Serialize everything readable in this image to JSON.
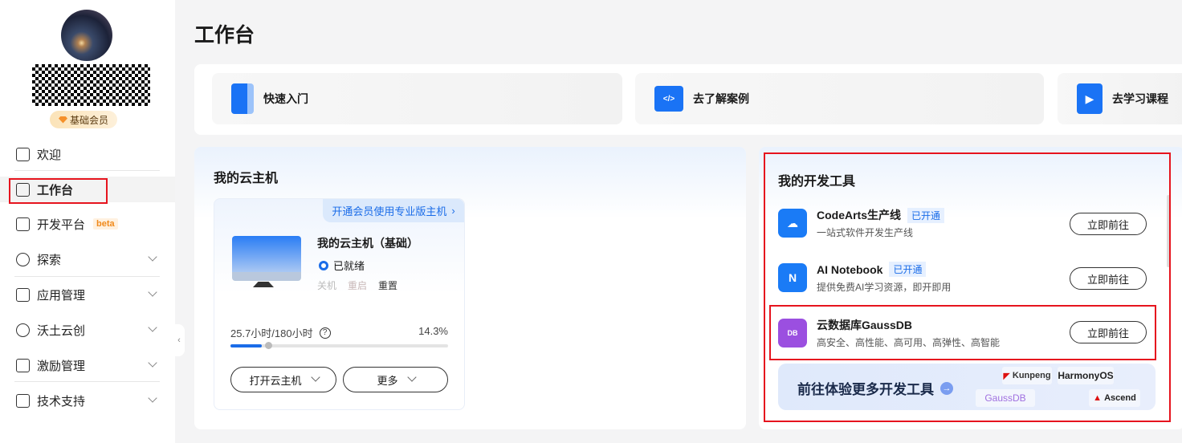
{
  "sidebar": {
    "member_badge": "基础会员",
    "items": [
      {
        "label": "欢迎",
        "icon": "home-icon"
      },
      {
        "label": "工作台",
        "icon": "workbench-icon",
        "selected": true
      },
      {
        "label": "开发平台",
        "icon": "dev-platform-icon",
        "badge": "beta"
      },
      {
        "label": "探索",
        "icon": "explore-icon"
      },
      {
        "label": "应用管理",
        "icon": "app-manage-icon"
      },
      {
        "label": "沃土云创",
        "icon": "cloud-icon"
      },
      {
        "label": "激励管理",
        "icon": "gift-icon"
      },
      {
        "label": "技术支持",
        "icon": "support-icon"
      }
    ]
  },
  "page_title": "工作台",
  "quick_links": [
    "快速入门",
    "去了解案例",
    "去学习课程"
  ],
  "cloud_host": {
    "title": "我的云主机",
    "upsell": "开通会员使用专业版主机",
    "name": "我的云主机（基础）",
    "status": "已就绪",
    "actions": [
      "关机",
      "重启",
      "重置"
    ],
    "usage": "25.7小时/180小时",
    "percent_text": "14.3%",
    "progress": 0.143,
    "open_button": "打开云主机",
    "more_button": "更多"
  },
  "dev_tools": {
    "title": "我的开发工具",
    "items": [
      {
        "name": "CodeArts生产线",
        "tag": "已开通",
        "desc": "一站式软件开发生产线",
        "button": "立即前往",
        "color": "#1a7bf6"
      },
      {
        "name": "AI Notebook",
        "tag": "已开通",
        "desc": "提供免费AI学习资源，即开即用",
        "button": "立即前往",
        "color": "#1a7bf6"
      },
      {
        "name": "云数据库GaussDB",
        "desc": "高安全、高性能、高可用、高弹性、高智能",
        "button": "立即前往",
        "color": "#9b4fe0"
      }
    ],
    "more_label": "前往体验更多开发工具",
    "logos": [
      "Kunpeng",
      "HarmonyOS",
      "GaussDB",
      "Ascend"
    ]
  }
}
